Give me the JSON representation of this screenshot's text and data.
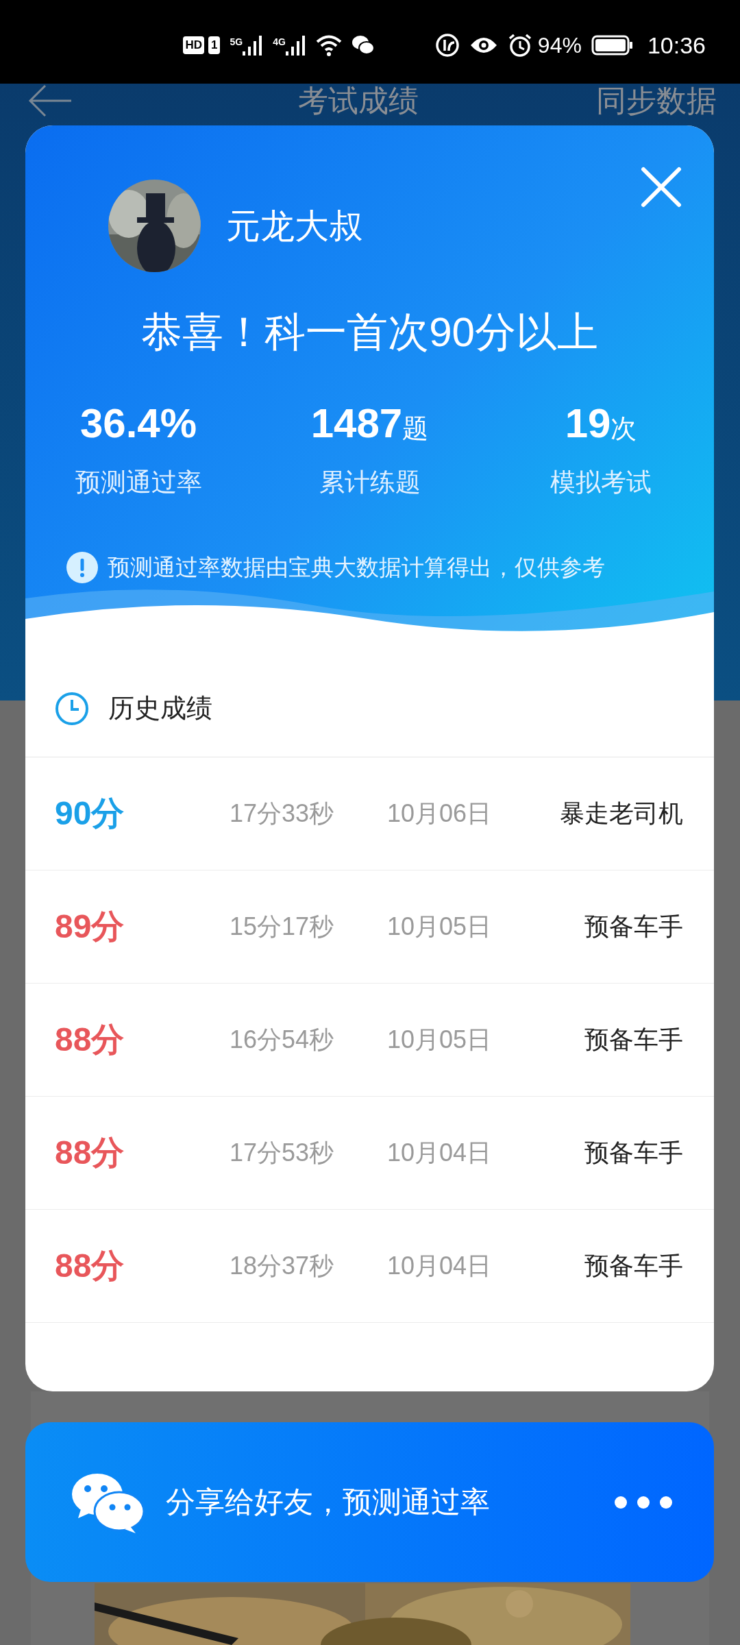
{
  "status_bar": {
    "hd": "HD",
    "sim": "1",
    "network_1": "5G",
    "network_2": "4G",
    "battery": "94%",
    "time": "10:36"
  },
  "page": {
    "title": "考试成绩",
    "action": "同步数据"
  },
  "dialog": {
    "user_name": "元龙大叔",
    "headline": "恭喜！科一首次90分以上",
    "stats": [
      {
        "value": "36.4%",
        "label": "预测通过率"
      },
      {
        "value": "1487",
        "unit": "题",
        "label": "累计练题"
      },
      {
        "value": "19",
        "unit": "次",
        "label": "模拟考试"
      }
    ],
    "notice": "预测通过率数据由宝典大数据计算得出，仅供参考",
    "history_title": "历史成绩",
    "rows": [
      {
        "score": "90分",
        "passed": true,
        "duration": "17分33秒",
        "date": "10月06日",
        "rank": "暴走老司机"
      },
      {
        "score": "89分",
        "passed": false,
        "duration": "15分17秒",
        "date": "10月05日",
        "rank": "预备车手"
      },
      {
        "score": "88分",
        "passed": false,
        "duration": "16分54秒",
        "date": "10月05日",
        "rank": "预备车手"
      },
      {
        "score": "88分",
        "passed": false,
        "duration": "17分53秒",
        "date": "10月04日",
        "rank": "预备车手"
      },
      {
        "score": "88分",
        "passed": false,
        "duration": "18分37秒",
        "date": "10月04日",
        "rank": "预备车手"
      }
    ]
  },
  "share_bar": {
    "label": "分享给好友，预测通过率"
  }
}
